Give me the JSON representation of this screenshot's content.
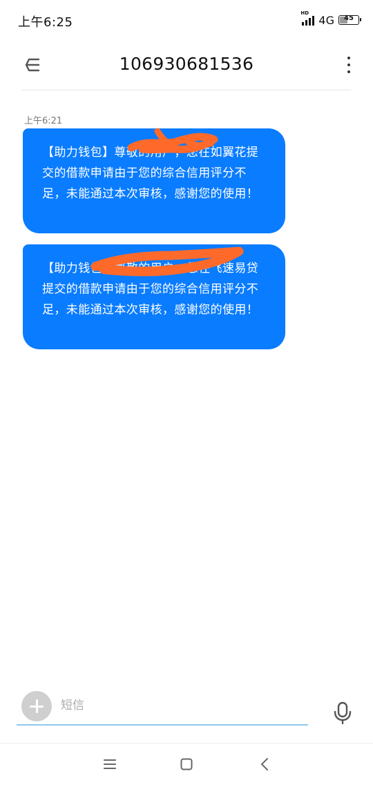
{
  "status_bar": {
    "time": "上午6:25",
    "hd_label": "HD",
    "network": "4G",
    "battery": 45,
    "battery_label": "45"
  },
  "header": {
    "title": "106930681536",
    "back_icon": "back-arrow-icon",
    "more_icon": "more-vertical-icon"
  },
  "messages": [
    {
      "timestamp": "上午6:21",
      "text": "【助力钱包】尊敬的用户，您在如翼花提交的借款申请由于您的综合信用评分不足，未能通过本次审核，感谢您的使用！"
    },
    {
      "text": "【助力钱包】尊敬的用户，您在飞速易贷提交的借款申请由于您的综合信用评分不足，未能通过本次审核，感谢您的使用！"
    }
  ],
  "composer": {
    "placeholder": "短信",
    "value": "",
    "add_icon": "plus-icon",
    "mic_icon": "microphone-icon"
  },
  "nav": {
    "menu_icon": "menu-icon",
    "home_icon": "home-square-icon",
    "back_icon": "back-chevron-icon"
  },
  "colors": {
    "bubble": "#0a7cff",
    "redaction": "#ff6a2b",
    "input_underline": "#8fc7ec"
  }
}
